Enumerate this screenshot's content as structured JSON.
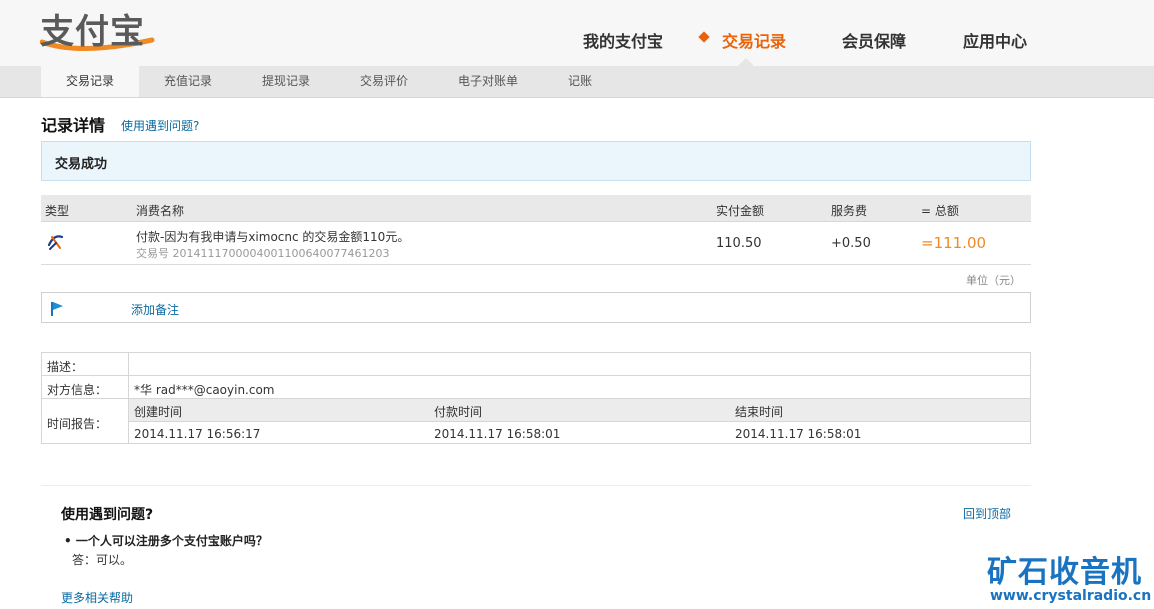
{
  "header": {
    "logo_text": "支付宝",
    "nav": [
      {
        "label": "我的支付宝"
      },
      {
        "label": "交易记录"
      },
      {
        "label": "会员保障"
      },
      {
        "label": "应用中心"
      }
    ],
    "accent_color": "#e8630a"
  },
  "subnav": [
    "交易记录",
    "充值记录",
    "提现记录",
    "交易评价",
    "电子对账单",
    "记账"
  ],
  "page": {
    "title": "记录详情",
    "help_link": "使用遇到问题?",
    "status": "交易成功"
  },
  "transaction": {
    "headers": {
      "type": "类型",
      "name": "消费名称",
      "paid": "实付金额",
      "fee": "服务费",
      "total": "= 总额"
    },
    "row": {
      "name": "付款-因为有我申请与ximocnc 的交易金额110元。",
      "trade_no": "交易号 2014111700004001100640077461203",
      "paid": "110.50",
      "fee": "+0.50",
      "total": "=111.00"
    },
    "unit": "单位（元）"
  },
  "remark": {
    "link": "添加备注"
  },
  "details": {
    "desc_label": "描述：",
    "desc_value": "",
    "counterparty_label": "对方信息：",
    "counterparty_value": "*华 rad***@caoyin.com",
    "time_label": "时间报告：",
    "time_headers": [
      "创建时间",
      "付款时间",
      "结束时间"
    ],
    "time_values": [
      "2014.11.17 16:56:17",
      "2014.11.17 16:58:01",
      "2014.11.17 16:58:01"
    ]
  },
  "faq": {
    "title": "使用遇到问题?",
    "back_to_top": "回到顶部",
    "question": "• 一个人可以注册多个支付宝账户吗？",
    "answer": "答：可以。",
    "more": "更多相关帮助"
  },
  "watermark": {
    "cn": "矿石收音机",
    "url": "www.crystalradio.cn"
  }
}
